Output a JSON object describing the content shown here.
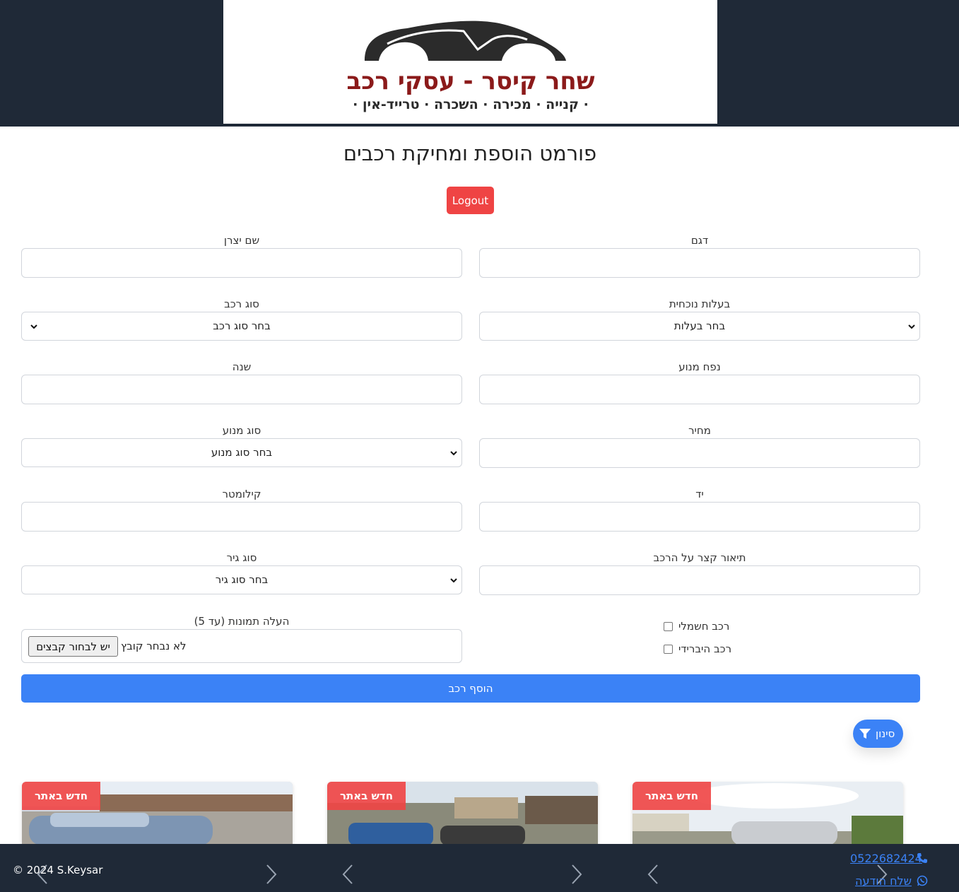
{
  "header": {
    "logo": {
      "name": "שחר  קיסר - עסקי  רכב",
      "tagline": "· קנייה · מכירה · השכרה · טרייד-אין ·"
    }
  },
  "page": {
    "title": "פורמט הוספת ומחיקת רכבים",
    "logout_label": "Logout"
  },
  "form": {
    "manufacturer_label": "שם יצרן",
    "model_label": "דגם",
    "vehicle_type_label": "סוג רכב",
    "vehicle_type_selected": "בחר סוג רכב",
    "ownership_label": "בעלות נוכחית",
    "ownership_selected": "בחר בעלות",
    "year_label": "שנה",
    "engine_volume_label": "נפח מנוע",
    "engine_type_label": "סוג מנוע",
    "engine_type_selected": "בחר סוג מנוע",
    "price_label": "מחיר",
    "km_label": "קילומטר",
    "hand_label": "יד",
    "gear_label": "סוג גיר",
    "gear_selected": "בחר סוג גיר",
    "description_label": "תיאור קצר על הרכב",
    "images_label": "העלה תמונות (עד 5)",
    "file_button": "יש לבחור קבצים",
    "file_status": "לא נבחר קובץ",
    "electric_label": "רכב חשמלי",
    "hybrid_label": "רכב היברידי",
    "submit_label": "הוסף רכב"
  },
  "filter": {
    "label": "סינון",
    "icon": "filter-icon"
  },
  "cards": [
    {
      "badge": "חדש באתר"
    },
    {
      "badge": "חדש באתר"
    },
    {
      "badge": "חדש באתר"
    }
  ],
  "footer": {
    "copyright": "© 2024 S.Keysar",
    "phone": "0522682424",
    "whatsapp_label": "שלח הודעה"
  },
  "colors": {
    "header_bg": "#1f2937",
    "primary": "#3b82f6",
    "danger": "#ef4444",
    "logo_red": "#8b1a1a"
  }
}
